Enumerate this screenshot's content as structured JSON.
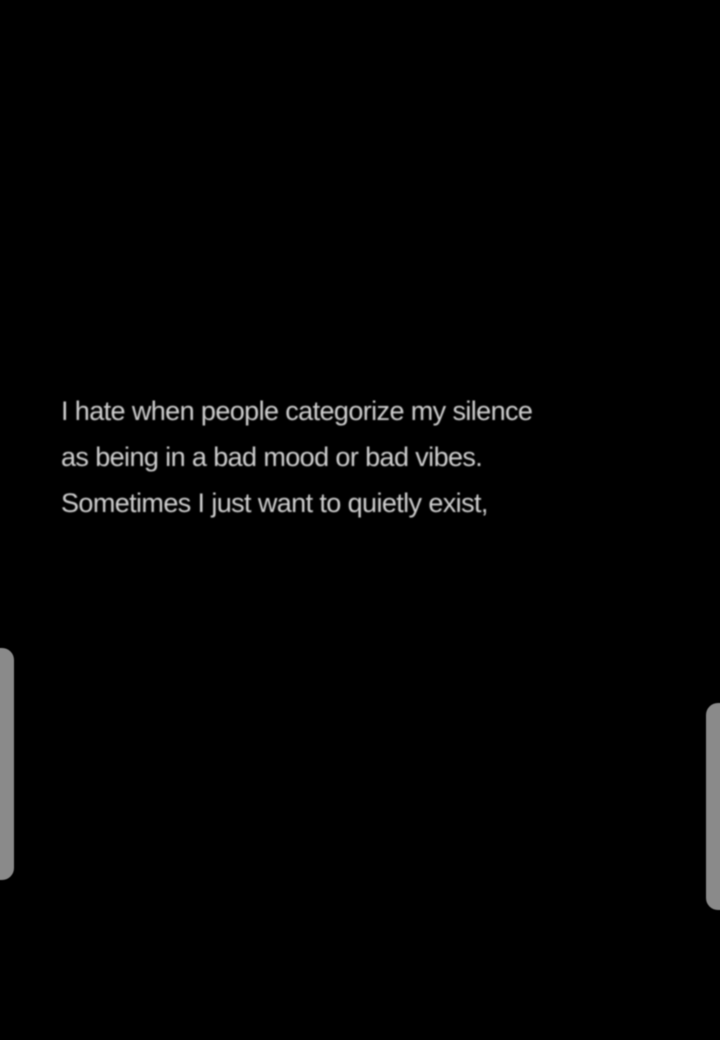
{
  "quote": {
    "lines": [
      "I hate when people categorize my silence",
      "as being in a bad mood or bad vibes.",
      "Sometimes I just want to quietly exist,"
    ]
  },
  "colors": {
    "background": "#000000",
    "text": "#cfcfcf",
    "handle": "#8a8a8a"
  },
  "handles": {
    "left_icon": "edge-handle-icon",
    "right_icon": "edge-handle-icon"
  }
}
